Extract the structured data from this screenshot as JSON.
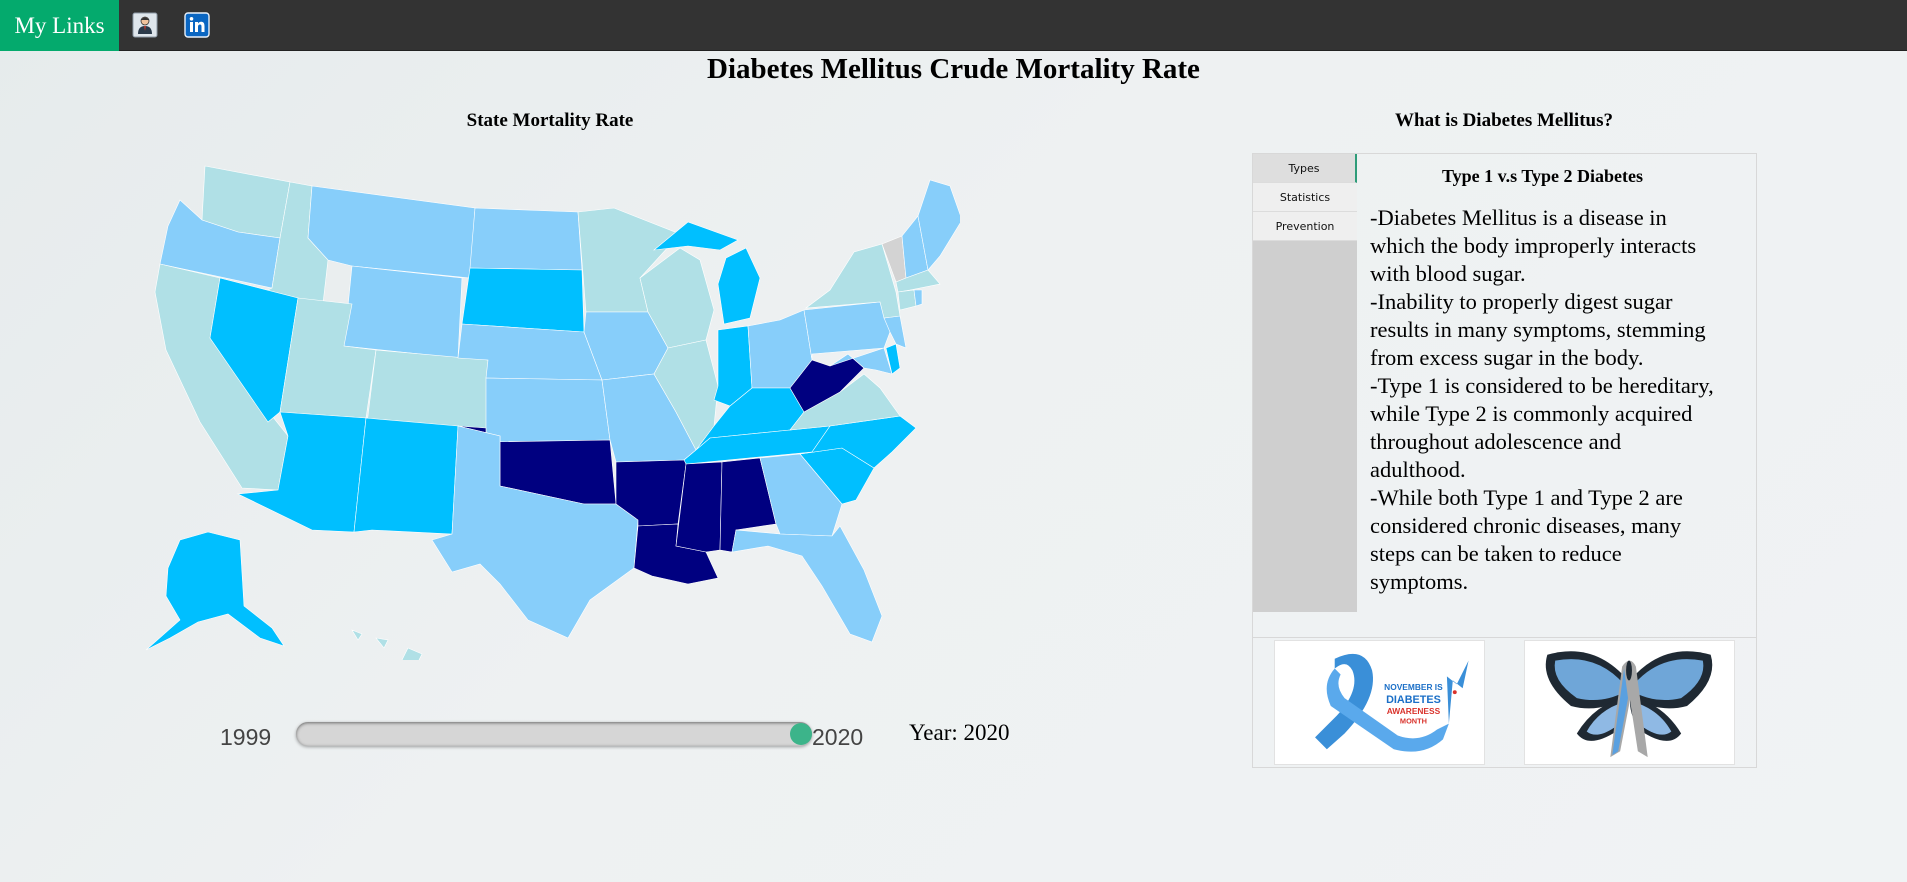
{
  "nav": {
    "brand": "My Links",
    "icons": [
      "resume-icon",
      "linkedin-icon"
    ]
  },
  "page": {
    "title": "Diabetes Mellitus Crude Mortality Rate"
  },
  "map": {
    "title": "State Mortality Rate",
    "colors": {
      "very_low": "#b0e0e6",
      "low": "#87cefa",
      "medium": "#00bfff",
      "high": "#000080",
      "no_data": "#d3d3d3"
    }
  },
  "slider": {
    "min_label": "1999",
    "max_label": "2020",
    "min": 1999,
    "max": 2020,
    "value": 2020,
    "year_text": "Year: 2020",
    "thumb_color": "#3cb48a"
  },
  "info": {
    "title": "What is Diabetes Mellitus?",
    "tabs": [
      {
        "label": "Types",
        "active": true
      },
      {
        "label": "Statistics",
        "active": false
      },
      {
        "label": "Prevention",
        "active": false
      }
    ],
    "active_heading": "Type 1 v.s Type 2 Diabetes",
    "active_body": [
      "-Diabetes Mellitus is a disease in which the body improperly interacts with blood sugar.",
      "-Inability to properly digest sugar results in many symptoms, stemming from excess sugar in the body.",
      "-Type 1 is considered to be hereditary, while Type 2 is commonly acquired throughout adolescence and adulthood.",
      "-While both Type 1 and Type 2 are considered chronic diseases, many steps can be taken to reduce symptoms."
    ]
  },
  "images": {
    "ribbon": {
      "line1": "NOVEMBER IS",
      "line2": "DIABETES",
      "line3": "AWARENESS",
      "line4": "MONTH"
    },
    "butterfly": {}
  }
}
